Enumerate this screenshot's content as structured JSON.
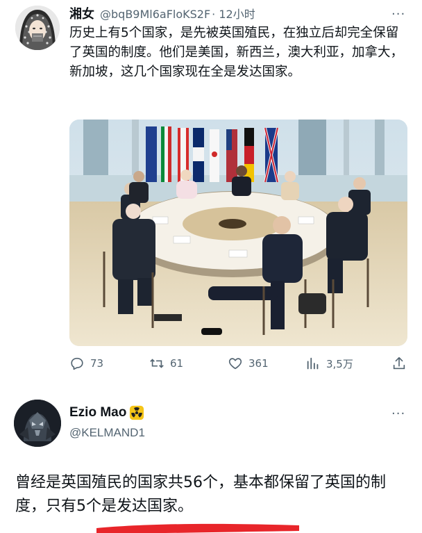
{
  "tweet1": {
    "author_name": "湘女",
    "handle": "@bqB9Ml6aFloKS2F",
    "timestamp": "· 12小时",
    "more_icon": "more-horizontal-icon",
    "text": "历史上有5个国家，是先被英国殖民，在独立后却完全保留了英国的制度。他们是美国，新西兰，澳大利亚，加拿大，新加坡，这几个国家现在全是发达国家。",
    "actions": {
      "reply": {
        "icon": "reply-icon",
        "count": "73"
      },
      "retweet": {
        "icon": "retweet-icon",
        "count": "61"
      },
      "like": {
        "icon": "heart-icon",
        "count": "361"
      },
      "views": {
        "icon": "analytics-icon",
        "count": "3,5万"
      },
      "share": {
        "icon": "share-icon"
      }
    }
  },
  "tweet2": {
    "author_name": "Ezio Mao",
    "badge_icon": "radioactive-emoji-icon",
    "handle": "@KELMAND1",
    "more_icon": "more-horizontal-icon",
    "text_part1": "曾经是英国殖民的国家共56个，基本都保留了英国的制度，",
    "text_part2": "只有5个是发达国家。"
  },
  "colors": {
    "text": "#0f1419",
    "secondary": "#536471",
    "highlight_underline": "#e8252a",
    "badge": "#f5c518"
  }
}
